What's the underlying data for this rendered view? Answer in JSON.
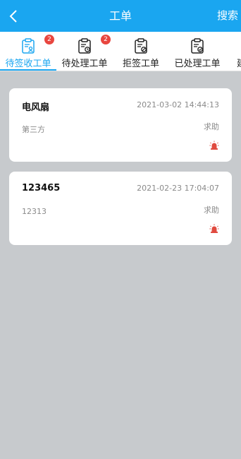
{
  "header": {
    "title": "工单",
    "search_label": "搜索",
    "back_icon": "chevron-left-icon",
    "bg_color": "#1aa6f0"
  },
  "tabs": [
    {
      "label": "待签收工单",
      "badge": "2",
      "active": true,
      "icon": "clipboard-user-icon"
    },
    {
      "label": "待处理工单",
      "badge": "2",
      "active": false,
      "icon": "clipboard-clock-icon"
    },
    {
      "label": "拒签工单",
      "badge": "",
      "active": false,
      "icon": "clipboard-block-icon"
    },
    {
      "label": "已处理工单",
      "badge": "",
      "active": false,
      "icon": "clipboard-check-icon"
    },
    {
      "label": "建",
      "badge": "",
      "active": false,
      "icon": ""
    }
  ],
  "orders": [
    {
      "title": "电风扇",
      "time": "2021-03-02 14:44:13",
      "sub": "第三方",
      "status": "求助",
      "icon": "alarm-light-icon"
    },
    {
      "title": "123465",
      "time": "2021-02-23 17:04:07",
      "sub": "12313",
      "status": "求助",
      "icon": "alarm-light-icon"
    }
  ],
  "colors": {
    "accent": "#1aa6f0",
    "badge": "#e8463f",
    "alarm": "#e04a3f",
    "background": "#c7cacd"
  }
}
